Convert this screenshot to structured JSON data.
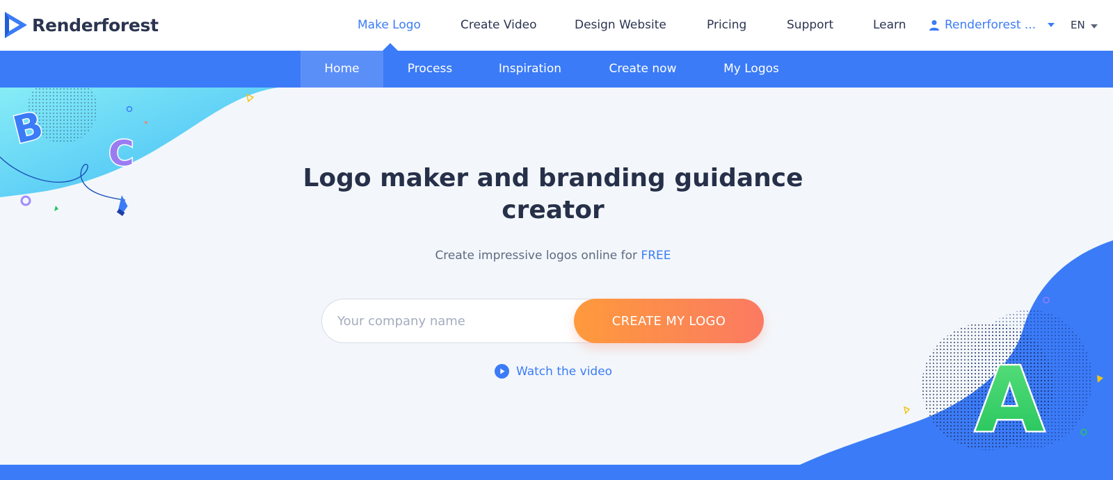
{
  "brand": {
    "name": "Renderforest",
    "icon": "renderforest-logo-icon"
  },
  "nav": {
    "items": [
      {
        "label": "Make Logo",
        "active": true
      },
      {
        "label": "Create Video"
      },
      {
        "label": "Design Website"
      },
      {
        "label": "Pricing"
      },
      {
        "label": "Support"
      },
      {
        "label": "Learn"
      }
    ],
    "user": {
      "label": "Renderforest ...",
      "icon": "user-icon"
    },
    "language": "EN"
  },
  "subnav": {
    "items": [
      {
        "label": "Home",
        "active": true
      },
      {
        "label": "Process"
      },
      {
        "label": "Inspiration"
      },
      {
        "label": "Create now"
      },
      {
        "label": "My Logos"
      }
    ]
  },
  "hero": {
    "headline": "Logo maker and branding guidance creator",
    "subline_prefix": "Create impressive logos online for",
    "subline_highlight": "FREE",
    "input_placeholder": "Your company name",
    "input_value": "",
    "cta_label": "CREATE MY LOGO",
    "watch_label": "Watch the video",
    "decor_letters": [
      "B",
      "C",
      "A"
    ]
  },
  "colors": {
    "accent": "#3b7bf7",
    "cta_start": "#fe9a3c",
    "cta_end": "#fb7a62",
    "text_dark": "#273049",
    "background": "#f3f7fb"
  }
}
